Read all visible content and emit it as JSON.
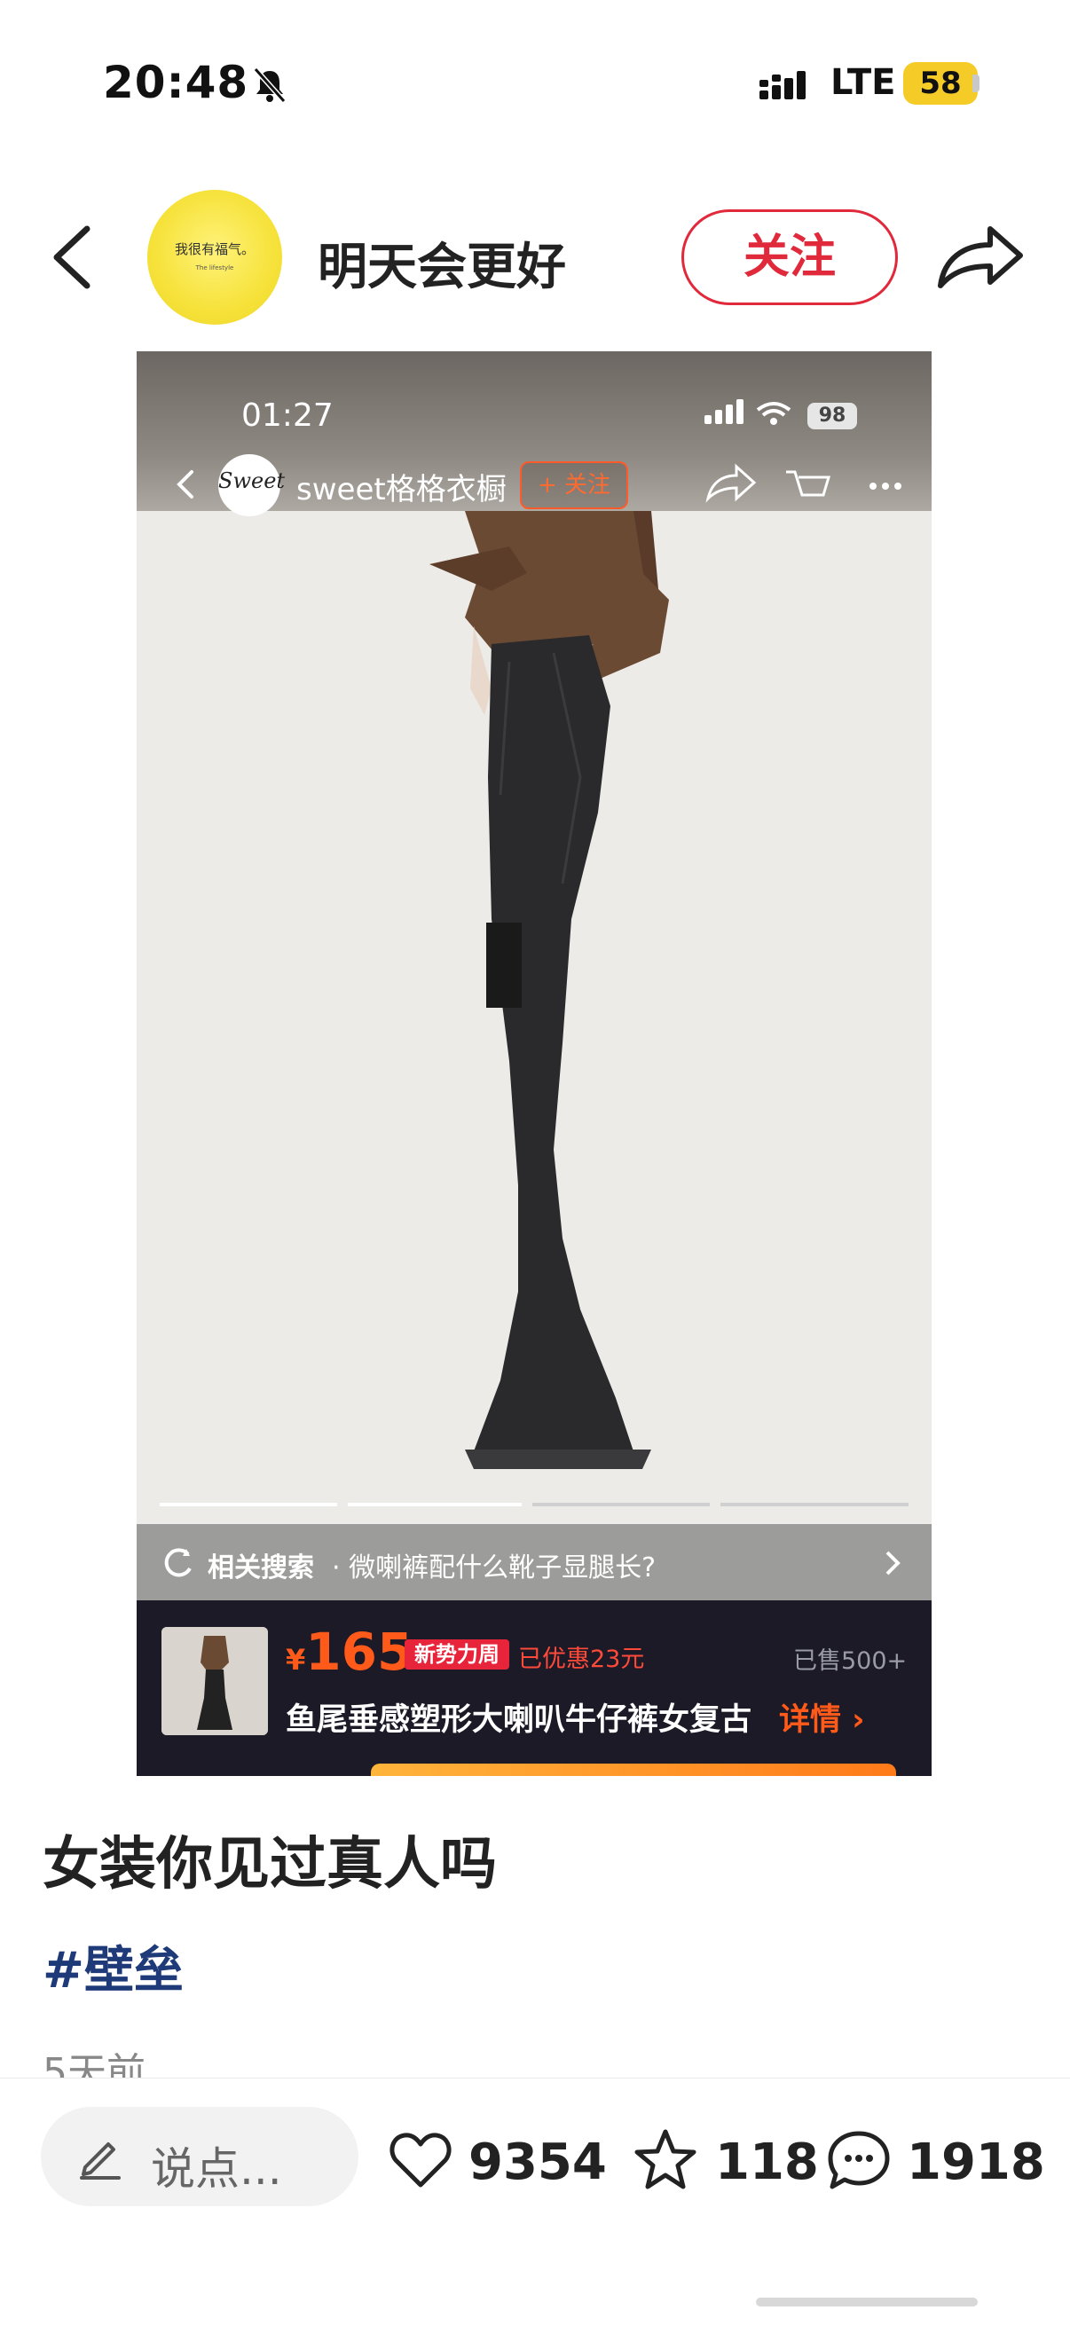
{
  "status_bar": {
    "time": "20:48",
    "network": "LTE",
    "battery": "58"
  },
  "header": {
    "author_name": "明天会更好",
    "avatar_text": "我很有福气。",
    "avatar_subtext": "The lifestyle",
    "follow_label": "关注"
  },
  "media": {
    "inner_time": "01:27",
    "inner_battery": "98",
    "shop_name": "sweet格格衣橱",
    "shop_logo_text": "Sweet",
    "inner_follow_label": "+ 关注",
    "related_label": "相关搜索",
    "related_query": "· 微喇裤配什么靴子显腿长?",
    "product": {
      "price_symbol": "¥",
      "price": "165",
      "promo_tag": "新势力周",
      "discount": "已优惠23元",
      "sold": "已售500+",
      "title": "鱼尾垂感塑形大喇叭牛仔裤女复古",
      "details_label": "详情 ›"
    }
  },
  "post": {
    "title": "女装你见过真人吗",
    "tag": "#壁垒",
    "time": "5天前"
  },
  "action_bar": {
    "comment_placeholder": "说点...",
    "likes": "9354",
    "favorites": "118",
    "comments": "1918"
  },
  "colors": {
    "accent_red": "#e02a3c",
    "tag_blue": "#1e3a78",
    "price_orange": "#ff5a1a",
    "battery_yellow": "#f5cc27"
  },
  "icons": [
    "bell-muted-icon",
    "signal-icon",
    "back-icon",
    "share-icon",
    "wifi-icon",
    "cart-icon",
    "more-icon",
    "search-refresh-icon",
    "chevron-right-icon",
    "pen-icon",
    "heart-icon",
    "star-icon",
    "comment-bubble-icon"
  ]
}
